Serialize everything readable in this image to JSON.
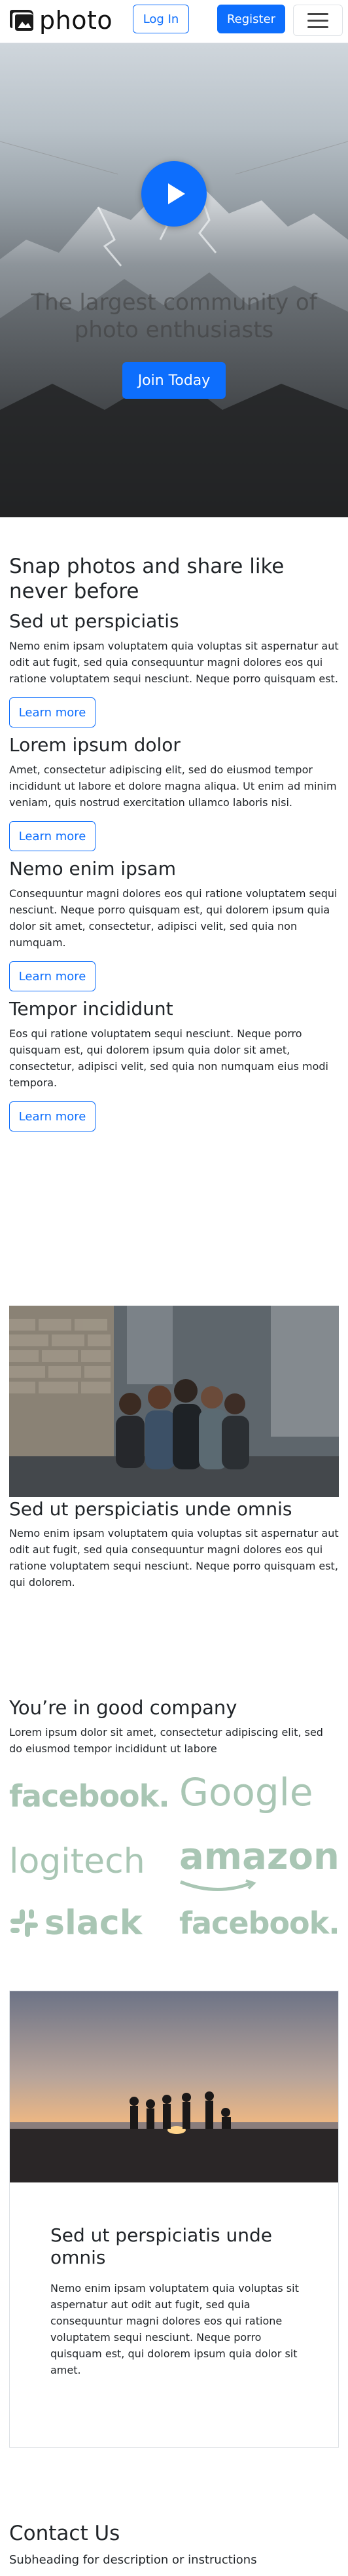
{
  "navbar": {
    "brand": "photo",
    "login_label": "Log In",
    "register_label": "Register",
    "menu_icon": "hamburger-icon"
  },
  "hero": {
    "title": "The largest community of photo enthusiasts",
    "join_label": "Join Today",
    "play_icon": "play-icon"
  },
  "features": {
    "heading": "Snap photos and share like never before",
    "items": [
      {
        "title": "Sed ut perspiciatis",
        "text": "Nemo enim ipsam voluptatem quia voluptas sit aspernatur aut odit aut fugit, sed quia consequuntur magni dolores eos qui ratione voluptatem sequi nesciunt. Neque porro quisquam est.",
        "button": "Learn more"
      },
      {
        "title": "Lorem ipsum dolor",
        "text": "Amet, consectetur adipiscing elit, sed do eiusmod tempor incididunt ut labore et dolore magna aliqua. Ut enim ad minim veniam, quis nostrud exercitation ullamco laboris nisi.",
        "button": "Learn more"
      },
      {
        "title": "Nemo enim ipsam",
        "text": "Consequuntur magni dolores eos qui ratione voluptatem sequi nesciunt. Neque porro quisquam est, qui dolorem ipsum quia dolor sit amet, consectetur, adipisci velit, sed quia non numquam.",
        "button": "Learn more"
      },
      {
        "title": "Tempor incididunt",
        "text": "Eos qui ratione voluptatem sequi nesciunt. Neque porro quisquam est, qui dolorem ipsum quia dolor sit amet, consectetur, adipisci velit, sed quia non numquam eius modi tempora.",
        "button": "Learn more"
      }
    ]
  },
  "photo_card": {
    "title": "Sed ut perspiciatis unde omnis",
    "text": "Nemo enim ipsam voluptatem quia voluptas sit aspernatur aut odit aut fugit, sed quia consequuntur magni dolores eos qui ratione voluptatem sequi nesciunt. Neque porro quisquam est, qui dolorem."
  },
  "company": {
    "title": "You’re in good company",
    "text": "Lorem ipsum dolor sit amet, consectetur adipiscing elit, sed do eiusmod tempor incididunt ut labore",
    "logos": [
      "facebook.",
      "Google",
      "logitech",
      "amazon",
      "slack",
      "facebook."
    ]
  },
  "bottom_card": {
    "title": "Sed ut perspiciatis unde omnis",
    "text": "Nemo enim ipsam voluptatem quia voluptas sit aspernatur aut odit aut fugit, sed quia consequuntur magni dolores eos qui ratione voluptatem sequi nesciunt. Neque porro quisquam est, qui dolorem ipsum quia dolor sit amet."
  },
  "contact": {
    "title": "Contact Us",
    "subtitle": "Subheading for description or instructions"
  },
  "colors": {
    "primary": "#0d6efd",
    "logo_green": "#a9c6b4"
  }
}
